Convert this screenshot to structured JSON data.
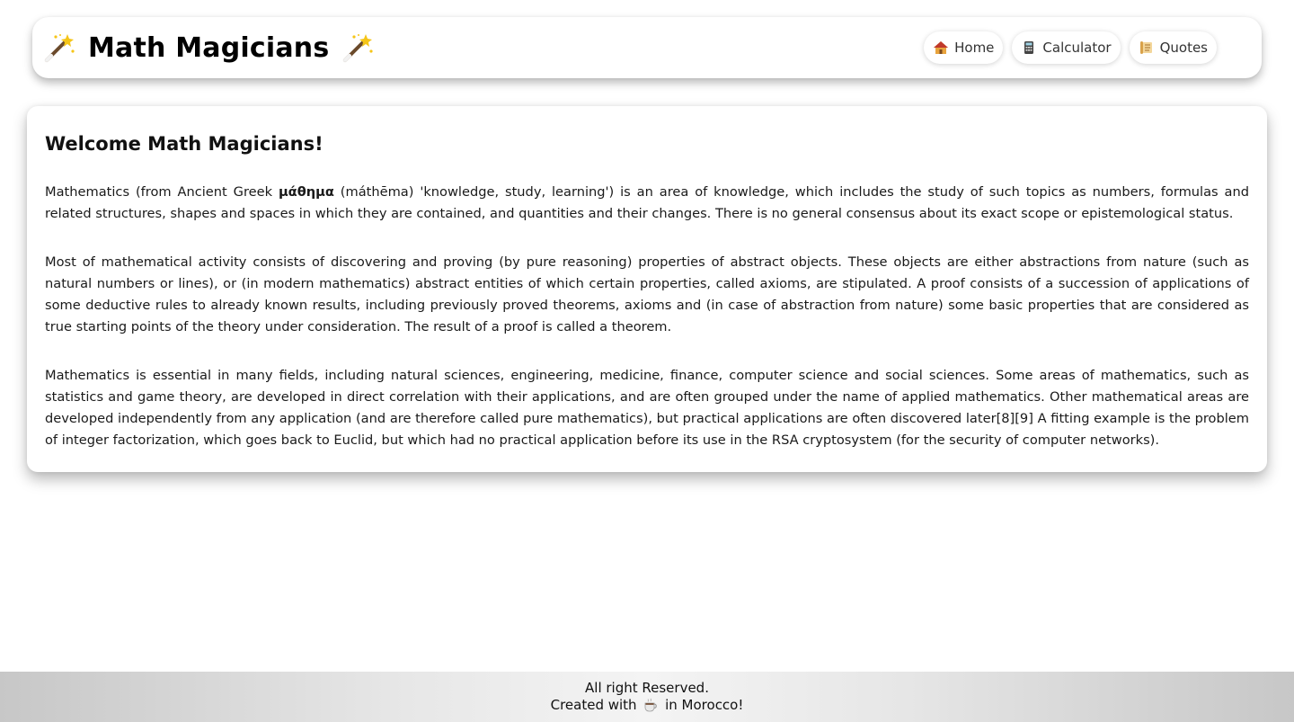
{
  "header": {
    "title": "Math Magicians",
    "left_icon": "magic-wand-icon",
    "right_icon": "magic-wand-icon",
    "nav": [
      {
        "label": "Home",
        "icon": "house-icon"
      },
      {
        "label": "Calculator",
        "icon": "calculator-icon"
      },
      {
        "label": "Quotes",
        "icon": "scroll-icon"
      }
    ]
  },
  "main": {
    "heading": "Welcome Math Magicians!",
    "p1_before": "Mathematics (from Ancient Greek ",
    "p1_greek": "μάθημα",
    "p1_after": " (máthēma) 'knowledge, study, learning') is an area of knowledge, which includes the study of such topics as numbers, formulas and related structures, shapes and spaces in which they are contained, and quantities and their changes. There is no general consensus about its exact scope or epistemological status.",
    "p2": "Most of mathematical activity consists of discovering and proving (by pure reasoning) properties of abstract objects. These objects are either abstractions from nature (such as natural numbers or lines), or (in modern mathematics) abstract entities of which certain properties, called axioms, are stipulated. A proof consists of a succession of applications of some deductive rules to already known results, including previously proved theorems, axioms and (in case of abstraction from nature) some basic properties that are considered as true starting points of the theory under consideration. The result of a proof is called a theorem.",
    "p3": "Mathematics is essential in many fields, including natural sciences, engineering, medicine, finance, computer science and social sciences. Some areas of mathematics, such as statistics and game theory, are developed in direct correlation with their applications, and are often grouped under the name of applied mathematics. Other mathematical areas are developed independently from any application (and are therefore called pure mathematics), but practical applications are often discovered later[8][9] A fitting example is the problem of integer factorization, which goes back to Euclid, but which had no practical application before its use in the RSA cryptosystem (for the security of computer networks)."
  },
  "footer": {
    "line1": "All right Reserved.",
    "line2_before": "Created with ",
    "line2_icon": "coffee-icon",
    "line2_after": " in Morocco!"
  }
}
